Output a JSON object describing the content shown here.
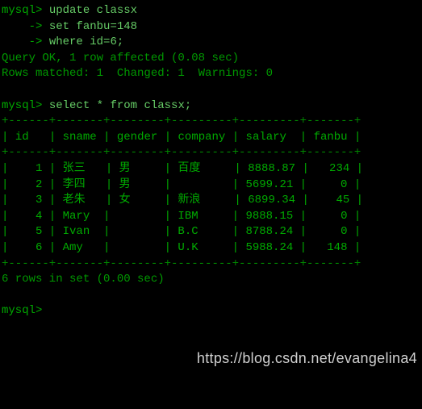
{
  "cmd1": {
    "prompt": "mysql>",
    "line1": "update classx",
    "cont": "    ->",
    "line2": "set fanbu=148",
    "line3": "where id=6;"
  },
  "result1": {
    "line1": "Query OK, 1 row affected (0.08 sec)",
    "line2": "Rows matched: 1  Changed: 1  Warnings: 0"
  },
  "cmd2": {
    "prompt": "mysql>",
    "text": "select * from classx;"
  },
  "table": {
    "border": "+------+-------+--------+---------+---------+-------+",
    "headers": {
      "c1": "id",
      "c2": "sname",
      "c3": "gender",
      "c4": "company",
      "c5": "salary",
      "c6": "fanbu"
    },
    "rows": [
      {
        "c1": "1",
        "c2": "张三",
        "c3": "男",
        "c4": "百度",
        "c5": "8888.87",
        "c6": "234"
      },
      {
        "c1": "2",
        "c2": "李四",
        "c3": "男",
        "c4": "",
        "c5": "5699.21",
        "c6": "0"
      },
      {
        "c1": "3",
        "c2": "老朱",
        "c3": "女",
        "c4": "新浪",
        "c5": "6899.34",
        "c6": "45"
      },
      {
        "c1": "4",
        "c2": "Mary",
        "c3": "",
        "c4": "IBM",
        "c5": "9888.15",
        "c6": "0"
      },
      {
        "c1": "5",
        "c2": "Ivan",
        "c3": "",
        "c4": "B.C",
        "c5": "8788.24",
        "c6": "0"
      },
      {
        "c1": "6",
        "c2": "Amy",
        "c3": "",
        "c4": "U.K",
        "c5": "5988.24",
        "c6": "148"
      }
    ]
  },
  "result2": "6 rows in set (0.00 sec)",
  "cmd3": {
    "prompt": "mysql>",
    "text": ""
  },
  "watermark": "https://blog.csdn.net/evangelina4"
}
